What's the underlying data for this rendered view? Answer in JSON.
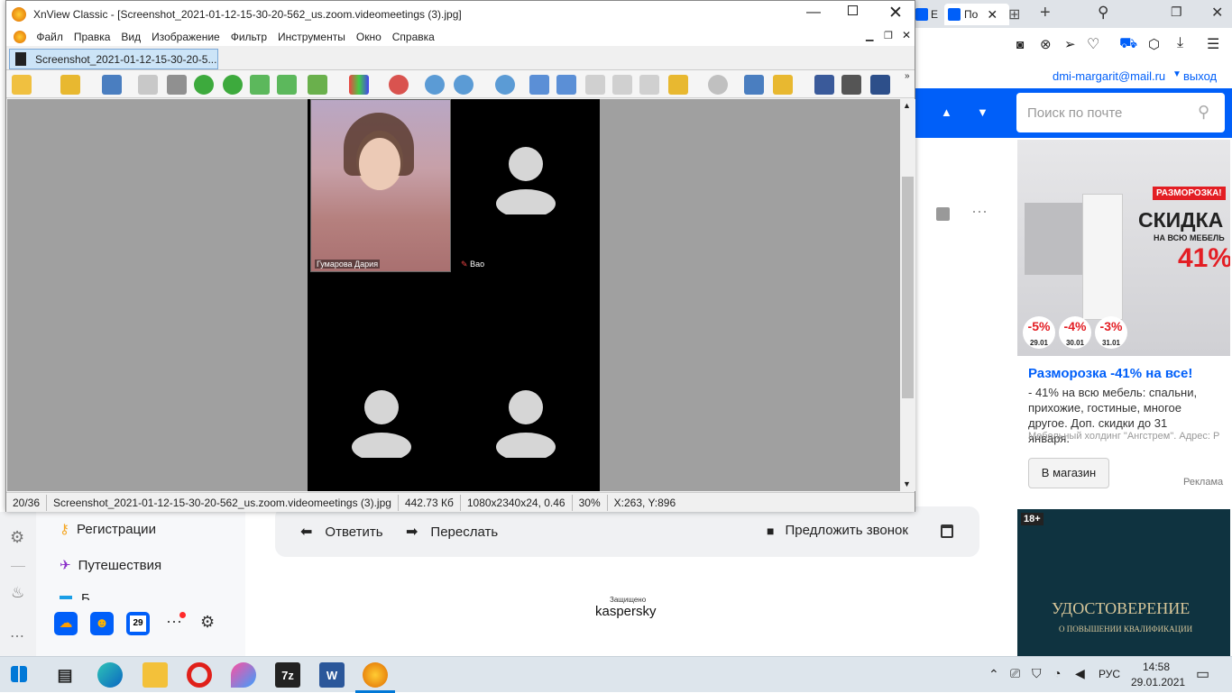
{
  "xnview": {
    "title": "XnView Classic - [Screenshot_2021-01-12-15-30-20-562_us.zoom.videomeetings (3).jpg]",
    "menu": [
      "Файл",
      "Правка",
      "Вид",
      "Изображение",
      "Фильтр",
      "Инструменты",
      "Окно",
      "Справка"
    ],
    "tab_label": "Screenshot_2021-01-12-15-30-20-5...",
    "status": {
      "index": "20/36",
      "filename": "Screenshot_2021-01-12-15-30-20-562_us.zoom.videomeetings (3).jpg",
      "size": "442.73 Кб",
      "dimensions": "1080x2340x24, 0.46",
      "zoom": "30%",
      "coords": "X:263, Y:896"
    },
    "image": {
      "participant_name": "Гумарова Дария",
      "participant2_name": "Вао"
    }
  },
  "browser": {
    "tab1_label": "Е",
    "tab2_label": "По",
    "user_email": "dmi-margarit@mail.ru",
    "logout": "выход",
    "search_placeholder": "Поиск по почте"
  },
  "ad": {
    "badge": "РАЗМОРОЗКА!",
    "headline": "СКИДКА",
    "subline": "НА ВСЮ МЕБЕЛЬ",
    "percent": "41%",
    "disc1": "-5%",
    "date1": "29.01",
    "disc2": "-4%",
    "date2": "30.01",
    "disc3": "-3%",
    "date3": "31.01",
    "title": "Разморозка -41% на все!",
    "text": "- 41% на всю мебель: спальни, прихожие, гостиные, многое другое. Доп. скидки до 31 января.",
    "advertiser": "Мебельный холдинг \"Ангстрем\". Адрес: Р",
    "button": "В магазин",
    "ad_label": "Реклама",
    "age": "18+",
    "banner2_title": "УДОСТОВЕРЕНИЕ",
    "banner2_sub": "О ПОВЫШЕНИИ КВАЛИФИКАЦИИ"
  },
  "mail": {
    "folder1": "Регистрации",
    "folder2": "Путешествия",
    "folder3": "Б",
    "reply": "Ответить",
    "forward": "Переслать",
    "suggest_call": "Предложить звонок",
    "protected_by": "Защищено",
    "kaspersky": "kaspersky",
    "calendar_day": "29"
  },
  "taskbar": {
    "lang": "РУС",
    "time": "14:58",
    "date": "29.01.2021",
    "word_letter": "W",
    "zip_label": "7z"
  }
}
